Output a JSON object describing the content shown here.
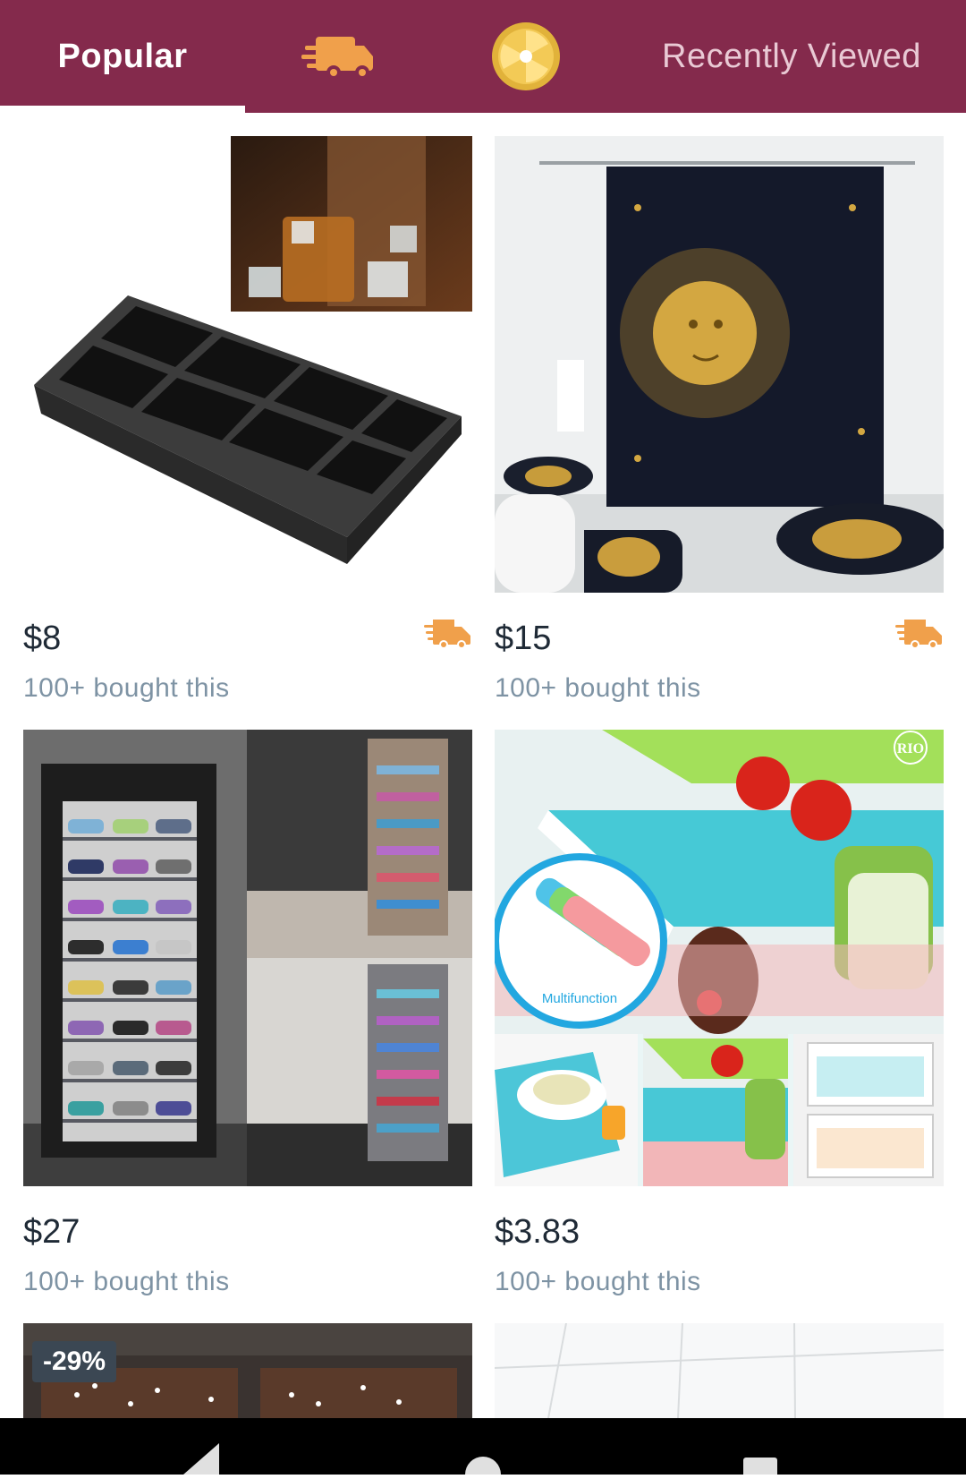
{
  "tabs": {
    "popular": "Popular",
    "shipping_icon": "delivery-truck-icon",
    "wheel_icon": "prize-wheel-icon",
    "recently_viewed": "Recently Viewed"
  },
  "products": [
    {
      "price": "$8",
      "sold": "100+ bought this",
      "image": "ice-cube-tray",
      "fast_shipping": true
    },
    {
      "price": "$15",
      "sold": "100+ bought this",
      "image": "sun-moon-shower-curtain",
      "fast_shipping": true
    },
    {
      "price": "$27",
      "sold": "100+ bought this",
      "image": "shoe-rack",
      "fast_shipping": false
    },
    {
      "price": "$3.83",
      "sold": "100+ bought this",
      "image": "fridge-liner-mats",
      "image_caption": "Multifunction",
      "fast_shipping": false
    },
    {
      "discount": "-29%",
      "image": "window-decor"
    },
    {
      "image": "bathroom-tile"
    }
  ],
  "colors": {
    "brand": "#842a4c",
    "truck": "#f0a04b",
    "price": "#1f2a36",
    "sold": "#7e93a4"
  }
}
